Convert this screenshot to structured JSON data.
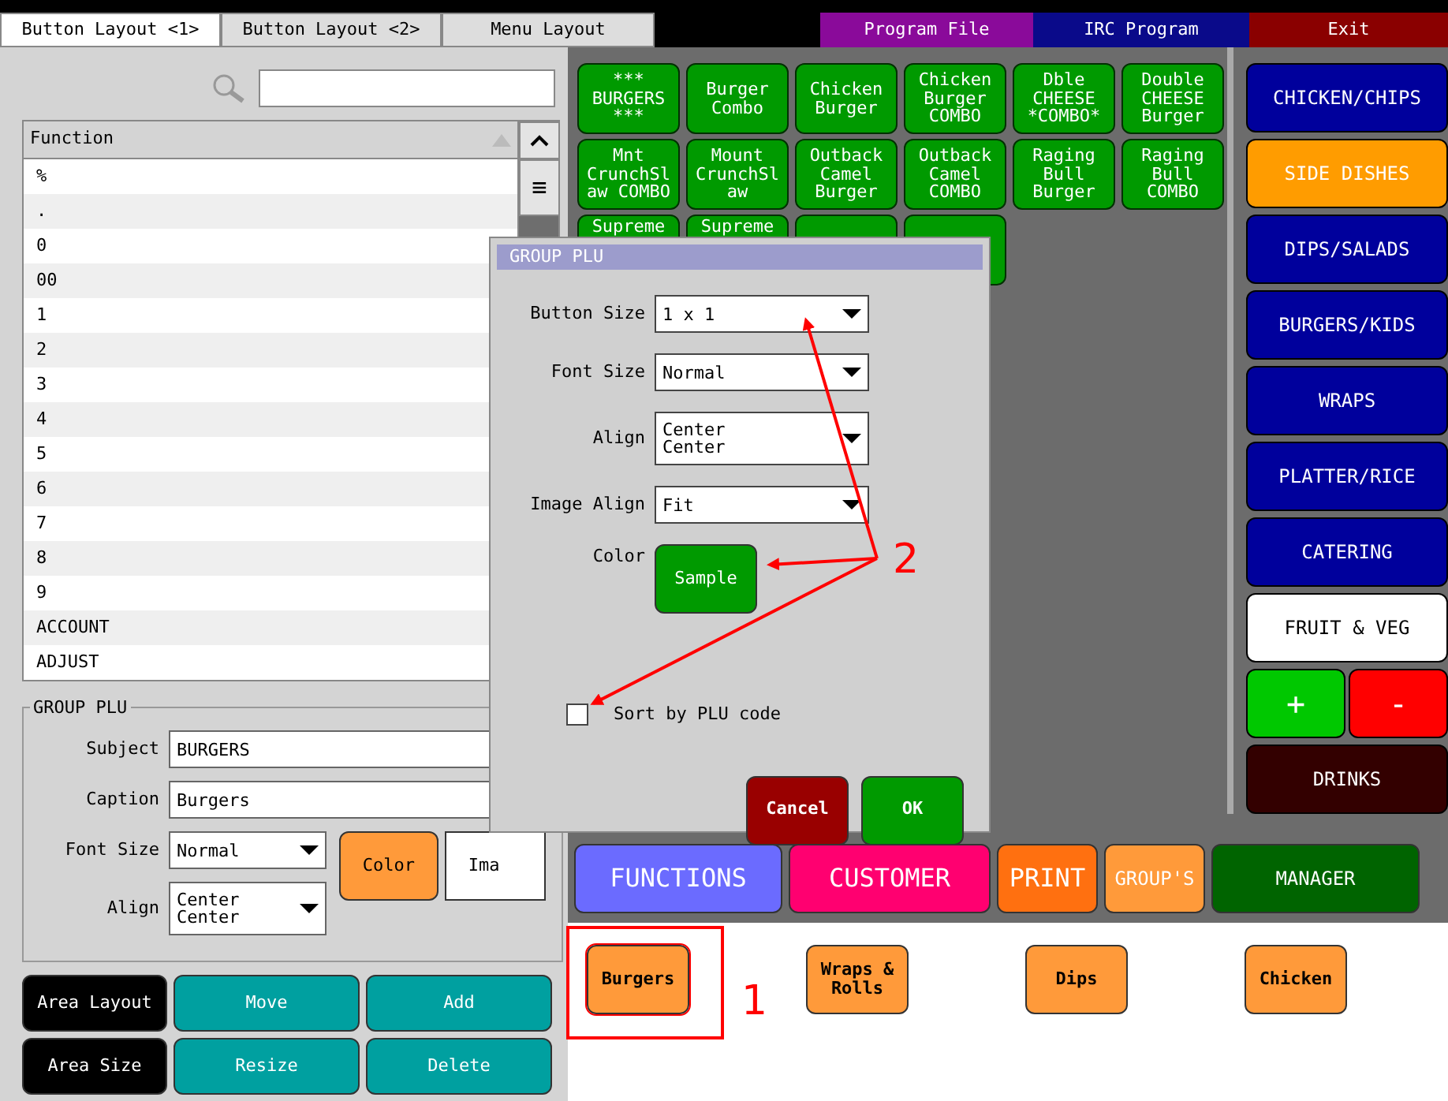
{
  "top_bar": {
    "tabs": [
      {
        "label": "Button Layout <1>",
        "selected": true
      },
      {
        "label": "Button Layout <2>",
        "selected": false
      },
      {
        "label": "Menu Layout",
        "selected": false
      }
    ],
    "buttons": [
      {
        "label": "Program File",
        "color": "#8a0a9a"
      },
      {
        "label": "IRC Program",
        "color": "#0a0a8a"
      },
      {
        "label": "Exit",
        "color": "#8a0000"
      }
    ]
  },
  "function_list": {
    "header": "Function",
    "handle": "≡",
    "rows": [
      "%",
      ".",
      "0",
      "00",
      "1",
      "2",
      "3",
      "4",
      "5",
      "6",
      "7",
      "8",
      "9",
      "ACCOUNT",
      "ADJUST"
    ]
  },
  "group_plu": {
    "title": "GROUP PLU",
    "subject_label": "Subject",
    "subject": "BURGERS",
    "caption_label": "Caption",
    "caption": "Burgers",
    "font_size_label": "Font Size",
    "font_size": "Normal",
    "align_label": "Align",
    "align": "Center\nCenter",
    "color_button": "Color",
    "image_button": "Ima"
  },
  "area_buttons": [
    {
      "label": "Area Layout",
      "kind": "mode"
    },
    {
      "label": "Move",
      "kind": "action"
    },
    {
      "label": "Add",
      "kind": "action"
    },
    {
      "label": "Area Size",
      "kind": "mode"
    },
    {
      "label": "Resize",
      "kind": "action"
    },
    {
      "label": "Delete",
      "kind": "action"
    }
  ],
  "menu_grid": [
    {
      "kind": "item",
      "label": "***\nBURGERS\n***"
    },
    {
      "kind": "item",
      "label": "Burger\nCombo"
    },
    {
      "kind": "item",
      "label": "Chicken\nBurger"
    },
    {
      "kind": "item",
      "label": "Chicken\nBurger\nCOMBO"
    },
    {
      "kind": "item",
      "label": "Dble\nCHEESE\n*COMBO*"
    },
    {
      "kind": "item",
      "label": "Double\nCHEESE\nBurger"
    },
    {
      "kind": "item",
      "label": "Mnt\nCrunchSl\naw COMBO"
    },
    {
      "kind": "item",
      "label": "Mount\nCrunchSl\naw"
    },
    {
      "kind": "item",
      "label": "Outback\nCamel\nBurger"
    },
    {
      "kind": "item",
      "label": "Outback\nCamel\nCOMBO"
    },
    {
      "kind": "item",
      "label": "Raging\nBull\nBurger"
    },
    {
      "kind": "item",
      "label": "Raging\nBull\nCOMBO"
    },
    {
      "kind": "partial",
      "label": "Supreme"
    },
    {
      "kind": "partial",
      "label": "Supreme"
    },
    {
      "kind": "blank"
    },
    {
      "kind": "blank"
    }
  ],
  "categories": [
    {
      "label": "CHICKEN/CHIPS",
      "color": "#00009c",
      "kind": "full"
    },
    {
      "label": "SIDE DISHES",
      "color": "#ff9c00",
      "kind": "full"
    },
    {
      "label": "DIPS/SALADS",
      "color": "#00009c",
      "kind": "full"
    },
    {
      "label": "BURGERS/KIDS",
      "color": "#00009c",
      "kind": "full"
    },
    {
      "label": "WRAPS",
      "color": "#00009c",
      "kind": "full"
    },
    {
      "label": "PLATTER/RICE",
      "color": "#00009c",
      "kind": "full"
    },
    {
      "label": "CATERING",
      "color": "#00009c",
      "kind": "full"
    },
    {
      "label": "FRUIT & VEG",
      "color": "#ffffff",
      "kind": "full"
    },
    {
      "label": "+",
      "color": "#00c800",
      "kind": "half"
    },
    {
      "label": "-",
      "color": "#ff0000",
      "kind": "half"
    },
    {
      "label": "DRINKS",
      "color": "#330000",
      "kind": "full"
    }
  ],
  "bottom_buttons": [
    {
      "label": "FUNCTIONS",
      "color": "#6b6bff"
    },
    {
      "label": "CUSTOMER",
      "color": "#ff0070"
    },
    {
      "label": "PRINT",
      "color": "#ff7010"
    },
    {
      "label": "GROUP'S",
      "color": "#ff9a3a"
    },
    {
      "label": "MANAGER",
      "color": "#006400"
    }
  ],
  "group_buttons": [
    {
      "label": "Burgers",
      "selected": true
    },
    {
      "label": "Wraps &\nRolls",
      "selected": false
    },
    {
      "label": "Dips",
      "selected": false
    },
    {
      "label": "Chicken",
      "selected": false
    }
  ],
  "dialog": {
    "title": "GROUP PLU",
    "fields": [
      {
        "label": "Button Size",
        "value": "1 x 1"
      },
      {
        "label": "Font Size",
        "value": "Normal"
      },
      {
        "label": "Align",
        "value": "Center\nCenter"
      },
      {
        "label": "Image Align",
        "value": "Fit"
      }
    ],
    "color_label": "Color",
    "color_sample": "Sample",
    "sort_label": "Sort by PLU code",
    "sort_checked": false,
    "cancel": "Cancel",
    "ok": "OK"
  },
  "annotations": [
    "1",
    "2"
  ]
}
